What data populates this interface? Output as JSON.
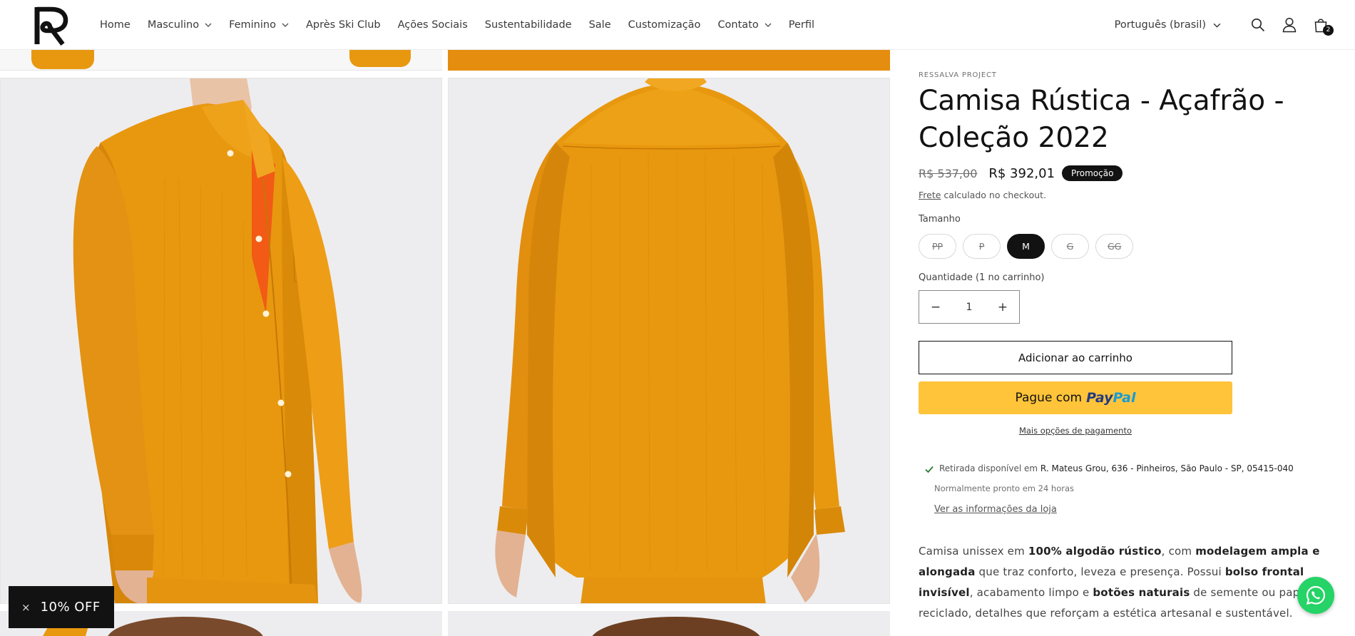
{
  "header": {
    "nav": [
      {
        "label": "Home",
        "dropdown": false
      },
      {
        "label": "Masculino",
        "dropdown": true
      },
      {
        "label": "Feminino",
        "dropdown": true
      },
      {
        "label": "Après Ski Club",
        "dropdown": false
      },
      {
        "label": "Ações Sociais",
        "dropdown": false
      },
      {
        "label": "Sustentabilidade",
        "dropdown": false
      },
      {
        "label": "Sale",
        "dropdown": false
      },
      {
        "label": "Customização",
        "dropdown": false
      },
      {
        "label": "Contato",
        "dropdown": true
      },
      {
        "label": "Perfil",
        "dropdown": false
      }
    ],
    "language": "Português (brasil)",
    "cart_count": "2",
    "icons": [
      "logo-r-icon",
      "search-icon",
      "account-icon",
      "cart-icon",
      "chevron-down-icon"
    ]
  },
  "product": {
    "vendor": "RESSALVA PROJECT",
    "title": "Camisa Rústica - Açafrão - Coleção 2022",
    "price_old": "R$ 537,00",
    "price_new": "R$ 392,01",
    "badge": "Promoção",
    "shipping_link": "Frete",
    "shipping_text": " calculado no checkout.",
    "size_label": "Tamanho",
    "sizes": [
      {
        "label": "PP",
        "available": false,
        "selected": false
      },
      {
        "label": "P",
        "available": false,
        "selected": false
      },
      {
        "label": "M",
        "available": true,
        "selected": true
      },
      {
        "label": "G",
        "available": false,
        "selected": false
      },
      {
        "label": "GG",
        "available": false,
        "selected": false
      }
    ],
    "quantity_label": "Quantidade (1 no carrinho)",
    "quantity": "1",
    "qty_minus": "−",
    "qty_plus": "+",
    "add_to_cart": "Adicionar ao carrinho",
    "paypal_prefix": "Pague com",
    "paypal_brand_1": "Pay",
    "paypal_brand_2": "Pal",
    "more_payment": "Mais opções de pagamento",
    "pickup_prefix": "Retirada disponível em ",
    "pickup_location": "R. Mateus Grou, 636 - Pinheiros, São Paulo - SP, 05415-040",
    "pickup_time": "Normalmente pronto em 24 horas",
    "store_info_link": "Ver as informações da loja",
    "description": {
      "p1": "Camisa unissex em ",
      "b1": "100% algodão rústico",
      "p2": ", com ",
      "b2": "modelagem ampla e alongada",
      "p3": " que traz conforto, leveza e presença. Possui ",
      "b3": "bolso frontal invisível",
      "p4": ", acabamento limpo e ",
      "b4": "botões naturais",
      "p5": " de semente ou papel reciclado, detalhes que reforçam a estética artesanal e sustentável."
    }
  },
  "colors": {
    "shirt": "#e8980f",
    "shirt_shadow": "#c97a06",
    "badge": "#121212",
    "paypal": "#ffc439",
    "whatsapp": "#25d366"
  },
  "popup": {
    "close": "×",
    "label": "10% OFF"
  }
}
